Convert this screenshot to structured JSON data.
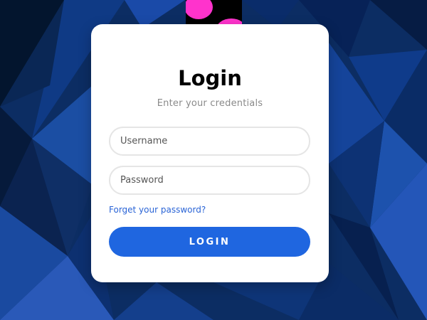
{
  "login_card": {
    "title": "Login",
    "subtitle": "Enter your credentials",
    "username_placeholder": "Username",
    "password_placeholder": "Password",
    "forgot_link": "Forget your password?",
    "submit_label": "LOGIN"
  },
  "colors": {
    "background": "#0b2a5c",
    "badge_background": "#000000",
    "badge_blob": "#ff33cc",
    "accent": "#1f66e0",
    "link": "#2a64d6"
  },
  "icons": {
    "background": "low-poly-pattern",
    "badge": "pink-blob-logo"
  }
}
